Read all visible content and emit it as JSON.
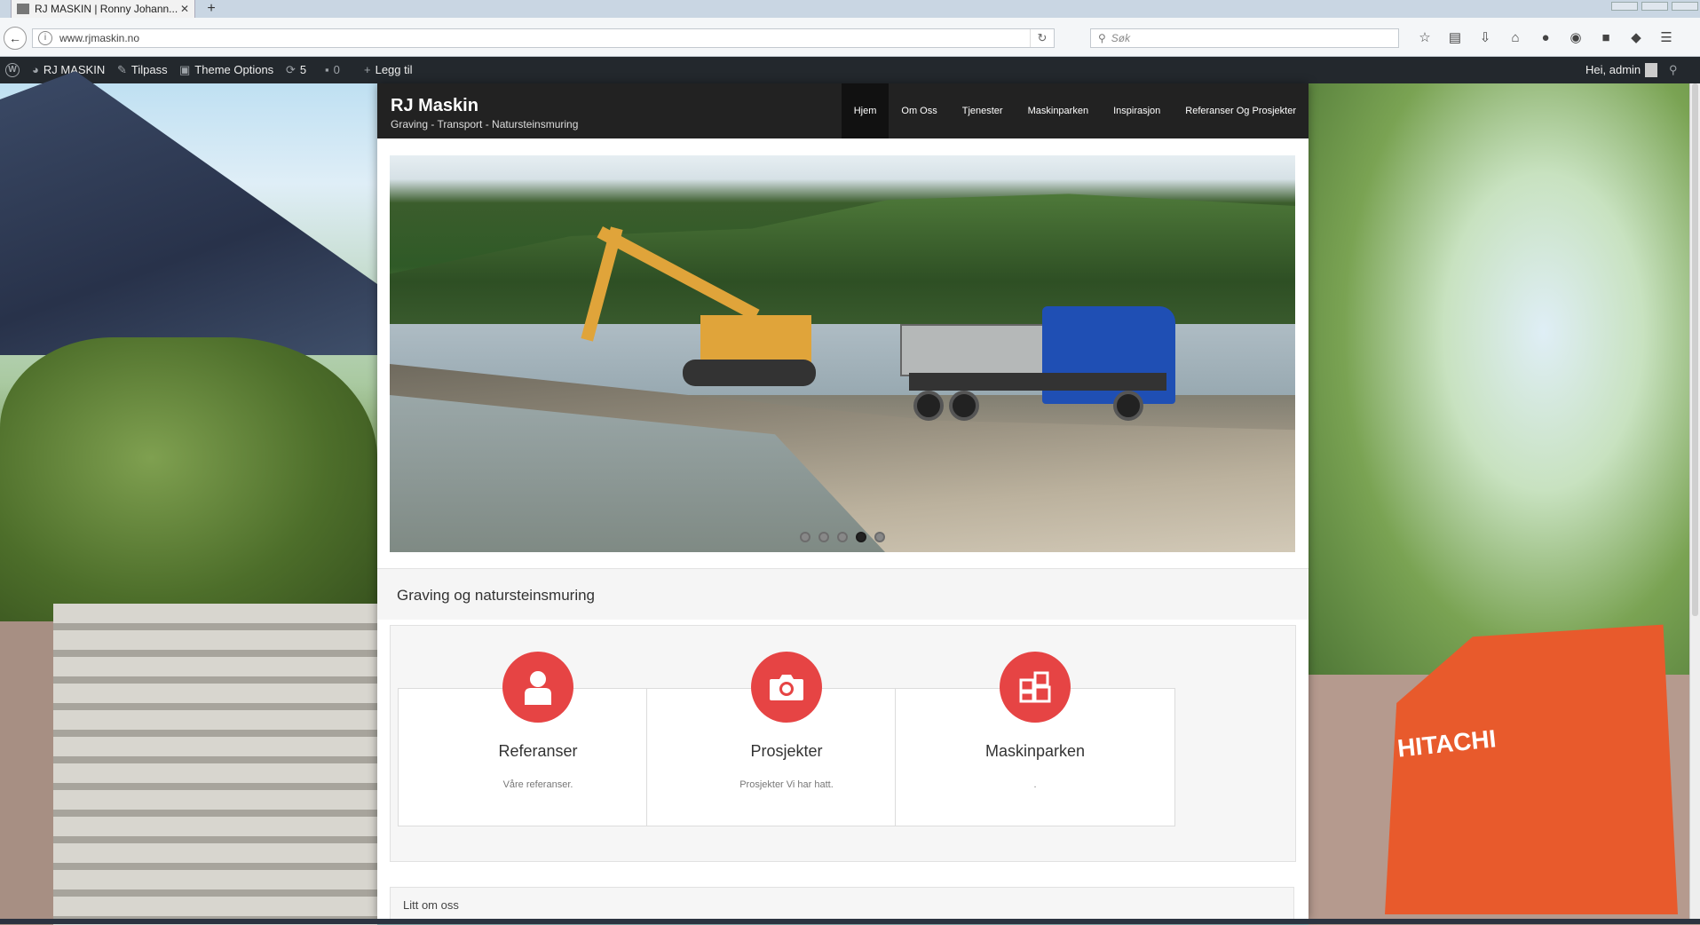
{
  "browser": {
    "tab_title": "RJ MASKIN | Ronny Johann...",
    "tab_close": "✕",
    "new_tab": "+",
    "url": "www.rjmaskin.no",
    "search_placeholder": "Søk"
  },
  "adminbar": {
    "wp_logo": "W",
    "site_name": "RJ MASKIN",
    "customize": "Tilpass",
    "theme_options": "Theme Options",
    "updates_count": "5",
    "comments_count": "0",
    "add_new": "Legg til",
    "greeting": "Hei, admin"
  },
  "site": {
    "title": "RJ Maskin",
    "tagline": "Graving - Transport - Natursteinsmuring"
  },
  "menu": {
    "items": [
      "Hjem",
      "Om Oss",
      "Tjenester",
      "Maskinparken",
      "Inspirasjon",
      "Referanser Og Prosjekter"
    ],
    "active_index": 0
  },
  "slider": {
    "dot_count": 5,
    "active_dot": 3
  },
  "intro": {
    "heading": "Graving og natursteinsmuring"
  },
  "features": [
    {
      "title": "Referanser",
      "description": "Våre referanser.",
      "icon": "user-icon"
    },
    {
      "title": "Prosjekter",
      "description": "Prosjekter Vi har hatt.",
      "icon": "camera-icon"
    },
    {
      "title": "Maskinparken",
      "description": ".",
      "icon": "machines-icon"
    }
  ],
  "about": {
    "heading": "Litt om oss"
  },
  "colors": {
    "accent": "#e64444",
    "header_bg": "#222222",
    "adminbar_bg": "#23282d"
  }
}
